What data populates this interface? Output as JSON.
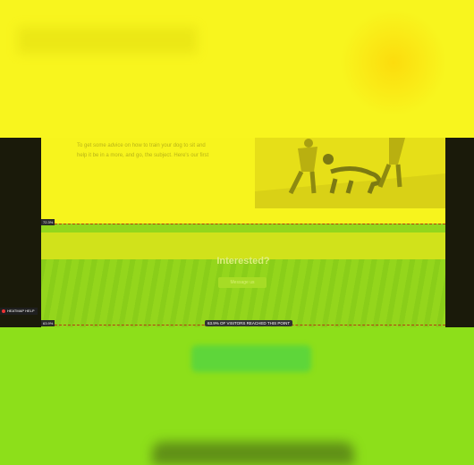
{
  "page": {
    "body_text": "To get some advice on how to train your dog to sit and help it be in a more, and go, the subject. Here's our first",
    "interested_heading": "Interested?",
    "message_button": "Message us"
  },
  "heatmap": {
    "marker_top": "72.3%",
    "marker_bottom": "63.9%",
    "reached_label": "63.9% OF VISITORS REACHED THIS POINT",
    "help_label": "HEATMAP HELP"
  },
  "colors": {
    "hot": "#f8f51e",
    "warm": "#93d71c",
    "line": "#b33a10"
  }
}
